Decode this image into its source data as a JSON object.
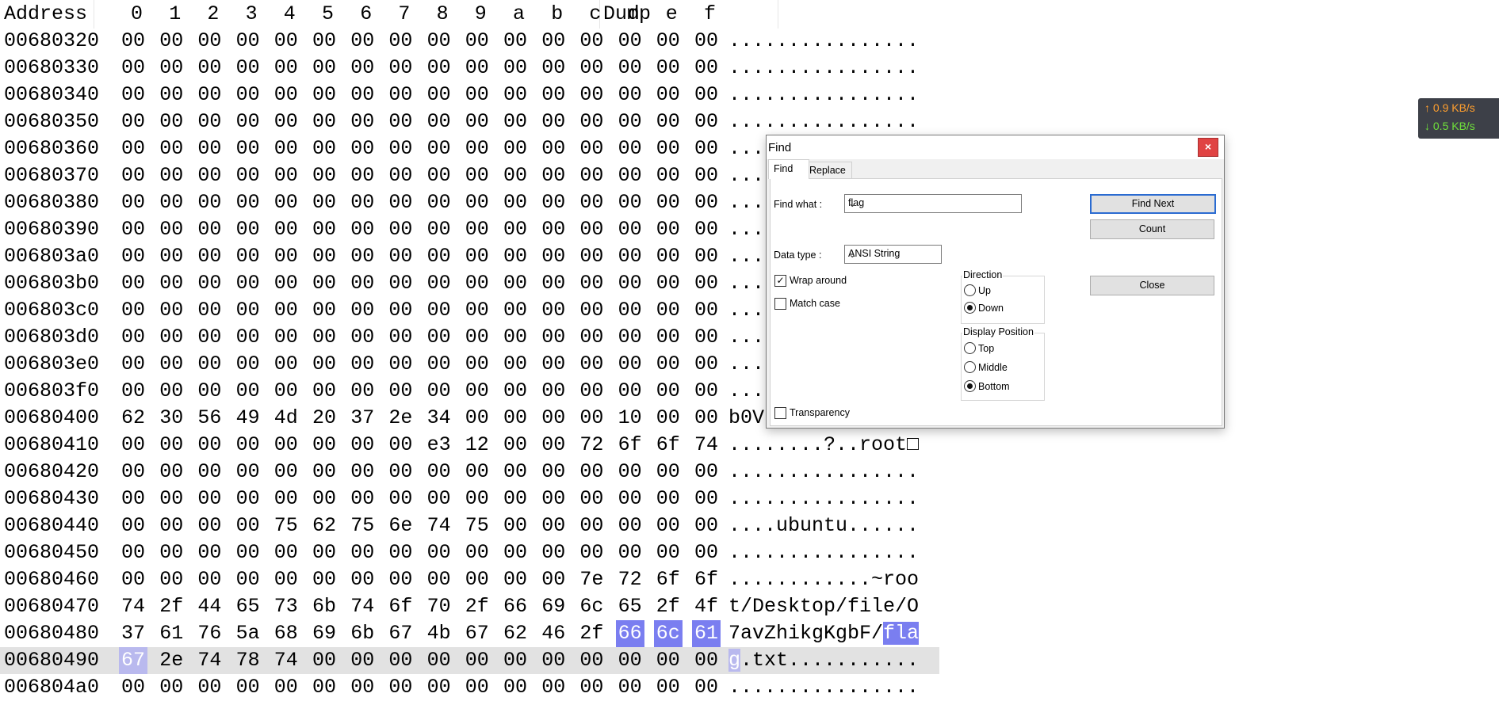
{
  "hex_header": {
    "address": "Address",
    "columns": [
      "0",
      "1",
      "2",
      "3",
      "4",
      "5",
      "6",
      "7",
      "8",
      "9",
      "a",
      "b",
      "c",
      "d",
      "e",
      "f"
    ],
    "dump": "Dump"
  },
  "hex_rows": [
    {
      "addr": "00680320",
      "bytes": [
        "00",
        "00",
        "00",
        "00",
        "00",
        "00",
        "00",
        "00",
        "00",
        "00",
        "00",
        "00",
        "00",
        "00",
        "00",
        "00"
      ],
      "dump": "................"
    },
    {
      "addr": "00680330",
      "bytes": [
        "00",
        "00",
        "00",
        "00",
        "00",
        "00",
        "00",
        "00",
        "00",
        "00",
        "00",
        "00",
        "00",
        "00",
        "00",
        "00"
      ],
      "dump": "................"
    },
    {
      "addr": "00680340",
      "bytes": [
        "00",
        "00",
        "00",
        "00",
        "00",
        "00",
        "00",
        "00",
        "00",
        "00",
        "00",
        "00",
        "00",
        "00",
        "00",
        "00"
      ],
      "dump": "................"
    },
    {
      "addr": "00680350",
      "bytes": [
        "00",
        "00",
        "00",
        "00",
        "00",
        "00",
        "00",
        "00",
        "00",
        "00",
        "00",
        "00",
        "00",
        "00",
        "00",
        "00"
      ],
      "dump": "................"
    },
    {
      "addr": "00680360",
      "bytes": [
        "00",
        "00",
        "00",
        "00",
        "00",
        "00",
        "00",
        "00",
        "00",
        "00",
        "00",
        "00",
        "00",
        "00",
        "00",
        "00"
      ],
      "dump": "..."
    },
    {
      "addr": "00680370",
      "bytes": [
        "00",
        "00",
        "00",
        "00",
        "00",
        "00",
        "00",
        "00",
        "00",
        "00",
        "00",
        "00",
        "00",
        "00",
        "00",
        "00"
      ],
      "dump": "..."
    },
    {
      "addr": "00680380",
      "bytes": [
        "00",
        "00",
        "00",
        "00",
        "00",
        "00",
        "00",
        "00",
        "00",
        "00",
        "00",
        "00",
        "00",
        "00",
        "00",
        "00"
      ],
      "dump": "..."
    },
    {
      "addr": "00680390",
      "bytes": [
        "00",
        "00",
        "00",
        "00",
        "00",
        "00",
        "00",
        "00",
        "00",
        "00",
        "00",
        "00",
        "00",
        "00",
        "00",
        "00"
      ],
      "dump": "..."
    },
    {
      "addr": "006803a0",
      "bytes": [
        "00",
        "00",
        "00",
        "00",
        "00",
        "00",
        "00",
        "00",
        "00",
        "00",
        "00",
        "00",
        "00",
        "00",
        "00",
        "00"
      ],
      "dump": "..."
    },
    {
      "addr": "006803b0",
      "bytes": [
        "00",
        "00",
        "00",
        "00",
        "00",
        "00",
        "00",
        "00",
        "00",
        "00",
        "00",
        "00",
        "00",
        "00",
        "00",
        "00"
      ],
      "dump": "..."
    },
    {
      "addr": "006803c0",
      "bytes": [
        "00",
        "00",
        "00",
        "00",
        "00",
        "00",
        "00",
        "00",
        "00",
        "00",
        "00",
        "00",
        "00",
        "00",
        "00",
        "00"
      ],
      "dump": "..."
    },
    {
      "addr": "006803d0",
      "bytes": [
        "00",
        "00",
        "00",
        "00",
        "00",
        "00",
        "00",
        "00",
        "00",
        "00",
        "00",
        "00",
        "00",
        "00",
        "00",
        "00"
      ],
      "dump": "..."
    },
    {
      "addr": "006803e0",
      "bytes": [
        "00",
        "00",
        "00",
        "00",
        "00",
        "00",
        "00",
        "00",
        "00",
        "00",
        "00",
        "00",
        "00",
        "00",
        "00",
        "00"
      ],
      "dump": "..."
    },
    {
      "addr": "006803f0",
      "bytes": [
        "00",
        "00",
        "00",
        "00",
        "00",
        "00",
        "00",
        "00",
        "00",
        "00",
        "00",
        "00",
        "00",
        "00",
        "00",
        "00"
      ],
      "dump": "..."
    },
    {
      "addr": "00680400",
      "bytes": [
        "62",
        "30",
        "56",
        "49",
        "4d",
        "20",
        "37",
        "2e",
        "34",
        "00",
        "00",
        "00",
        "00",
        "10",
        "00",
        "00"
      ],
      "dump": "b0V"
    },
    {
      "addr": "00680410",
      "bytes": [
        "00",
        "00",
        "00",
        "00",
        "00",
        "00",
        "00",
        "00",
        "e3",
        "12",
        "00",
        "00",
        "72",
        "6f",
        "6f",
        "74"
      ],
      "dump": "........?..root□"
    },
    {
      "addr": "00680420",
      "bytes": [
        "00",
        "00",
        "00",
        "00",
        "00",
        "00",
        "00",
        "00",
        "00",
        "00",
        "00",
        "00",
        "00",
        "00",
        "00",
        "00"
      ],
      "dump": "................"
    },
    {
      "addr": "00680430",
      "bytes": [
        "00",
        "00",
        "00",
        "00",
        "00",
        "00",
        "00",
        "00",
        "00",
        "00",
        "00",
        "00",
        "00",
        "00",
        "00",
        "00"
      ],
      "dump": "................"
    },
    {
      "addr": "00680440",
      "bytes": [
        "00",
        "00",
        "00",
        "00",
        "75",
        "62",
        "75",
        "6e",
        "74",
        "75",
        "00",
        "00",
        "00",
        "00",
        "00",
        "00"
      ],
      "dump": "....ubuntu......"
    },
    {
      "addr": "00680450",
      "bytes": [
        "00",
        "00",
        "00",
        "00",
        "00",
        "00",
        "00",
        "00",
        "00",
        "00",
        "00",
        "00",
        "00",
        "00",
        "00",
        "00"
      ],
      "dump": "................"
    },
    {
      "addr": "00680460",
      "bytes": [
        "00",
        "00",
        "00",
        "00",
        "00",
        "00",
        "00",
        "00",
        "00",
        "00",
        "00",
        "00",
        "7e",
        "72",
        "6f",
        "6f"
      ],
      "dump": "............~roo"
    },
    {
      "addr": "00680470",
      "bytes": [
        "74",
        "2f",
        "44",
        "65",
        "73",
        "6b",
        "74",
        "6f",
        "70",
        "2f",
        "66",
        "69",
        "6c",
        "65",
        "2f",
        "4f"
      ],
      "dump": "t/Desktop/file/O"
    },
    {
      "addr": "00680480",
      "bytes": [
        "37",
        "61",
        "76",
        "5a",
        "68",
        "69",
        "6b",
        "67",
        "4b",
        "67",
        "62",
        "46",
        "2f",
        "66",
        "6c",
        "61"
      ],
      "dump": "7avZhikgKgbF/fla",
      "hl_from": 13,
      "dump_pre": "7avZhikgKgbF/",
      "dump_hl": "fla",
      "dump_post": ""
    },
    {
      "addr": "00680490",
      "bytes": [
        "67",
        "2e",
        "74",
        "78",
        "74",
        "00",
        "00",
        "00",
        "00",
        "00",
        "00",
        "00",
        "00",
        "00",
        "00",
        "00"
      ],
      "dump": "g.txt...........",
      "selected": true,
      "hl_to": 0,
      "dump_pre": "",
      "dump_hl": "g",
      "dump_post": ".txt..........."
    },
    {
      "addr": "006804a0",
      "bytes": [
        "00",
        "00",
        "00",
        "00",
        "00",
        "00",
        "00",
        "00",
        "00",
        "00",
        "00",
        "00",
        "00",
        "00",
        "00",
        "00"
      ],
      "dump": "................"
    }
  ],
  "net": {
    "up": "↑ 0.9 KB/s",
    "down": "↓ 0.5 KB/s"
  },
  "dialog": {
    "title": "Find",
    "close": "×",
    "tabs": [
      "Find",
      "Replace"
    ],
    "find_what_label": "Find what :",
    "find_what_value": "flag",
    "data_type_label": "Data type :",
    "data_type_value": "ANSI String",
    "wrap_around": {
      "label": "Wrap around",
      "checked": true
    },
    "match_case": {
      "label": "Match case",
      "checked": false
    },
    "transparency": {
      "label": "Transparency",
      "checked": false
    },
    "direction": {
      "title": "Direction",
      "options": [
        "Up",
        "Down"
      ],
      "selected": "Down"
    },
    "display_position": {
      "title": "Display Position",
      "options": [
        "Top",
        "Middle",
        "Bottom"
      ],
      "selected": "Bottom"
    },
    "buttons": {
      "find_next": "Find Next",
      "count": "Count",
      "close": "Close"
    }
  }
}
